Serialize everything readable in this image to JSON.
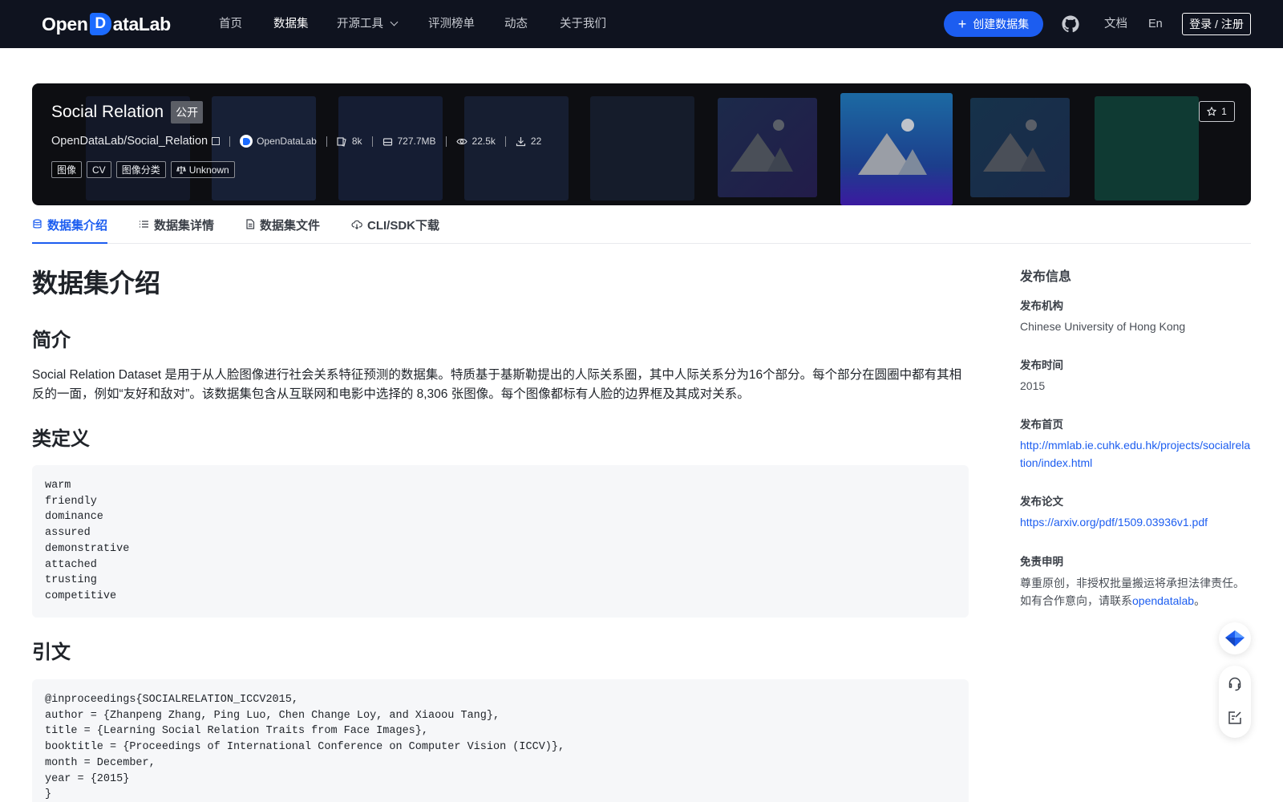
{
  "nav": {
    "logo_text_left": "Open",
    "logo_text_mark": "D",
    "logo_text_right": "ataLab",
    "items": [
      "首页",
      "数据集",
      "开源工具",
      "评测榜单",
      "动态",
      "关于我们"
    ],
    "create_label": "创建数据集",
    "docs_label": "文档",
    "lang_label": "En",
    "login_label": "登录 / 注册"
  },
  "dataset": {
    "title": "Social Relation",
    "visibility": "公开",
    "path": "OpenDataLab/Social_Relation",
    "org": "OpenDataLab",
    "files": "8k",
    "size": "727.7MB",
    "views": "22.5k",
    "downloads": "22",
    "tags": [
      "图像",
      "CV",
      "图像分类"
    ],
    "license": "Unknown",
    "stars": "1"
  },
  "tabs": [
    "数据集介绍",
    "数据集详情",
    "数据集文件",
    "CLI/SDK下载"
  ],
  "content": {
    "page_title": "数据集介绍",
    "intro_heading": "简介",
    "intro_text": "Social Relation Dataset 是用于从人脸图像进行社会关系特征预测的数据集。特质基于基斯勒提出的人际关系圈，其中人际关系分为16个部分。每个部分在圆圈中都有其相反的一面，例如“友好和敌对”。该数据集包含从互联网和电影中选择的 8,306 张图像。每个图像都标有人脸的边界框及其成对关系。",
    "classes_heading": "类定义",
    "classes_code": "warm\nfriendly\ndominance\nassured\ndemonstrative\nattached\ntrusting\ncompetitive",
    "citation_heading": "引文",
    "citation_code": "@inproceedings{SOCIALRELATION_ICCV2015,\nauthor = {Zhanpeng Zhang, Ping Luo, Chen Change Loy, and Xiaoou Tang},\ntitle = {Learning Social Relation Traits from Face Images},\nbooktitle = {Proceedings of International Conference on Computer Vision (ICCV)},\nmonth = December,\nyear = {2015}\n}"
  },
  "sidebar": {
    "title": "发布信息",
    "org_label": "发布机构",
    "org_value": "Chinese University of Hong Kong",
    "time_label": "发布时间",
    "time_value": "2015",
    "home_label": "发布首页",
    "home_value": "http://mmlab.ie.cuhk.edu.hk/projects/socialrelation/index.html",
    "paper_label": "发布论文",
    "paper_value": "https://arxiv.org/pdf/1509.03936v1.pdf",
    "disclaimer_label": "免责申明",
    "disclaimer_text_1": "尊重原创，非授权批量搬运将承担法律责任。",
    "disclaimer_text_2": "如有合作意向，请联系",
    "disclaimer_link": "opendatalab",
    "disclaimer_text_3": "。"
  },
  "colors": {
    "nav_bg": "#0f131f",
    "accent": "#1c5df0",
    "banner_bg": "#0d0e12",
    "code_bg": "#f6f7f9"
  }
}
